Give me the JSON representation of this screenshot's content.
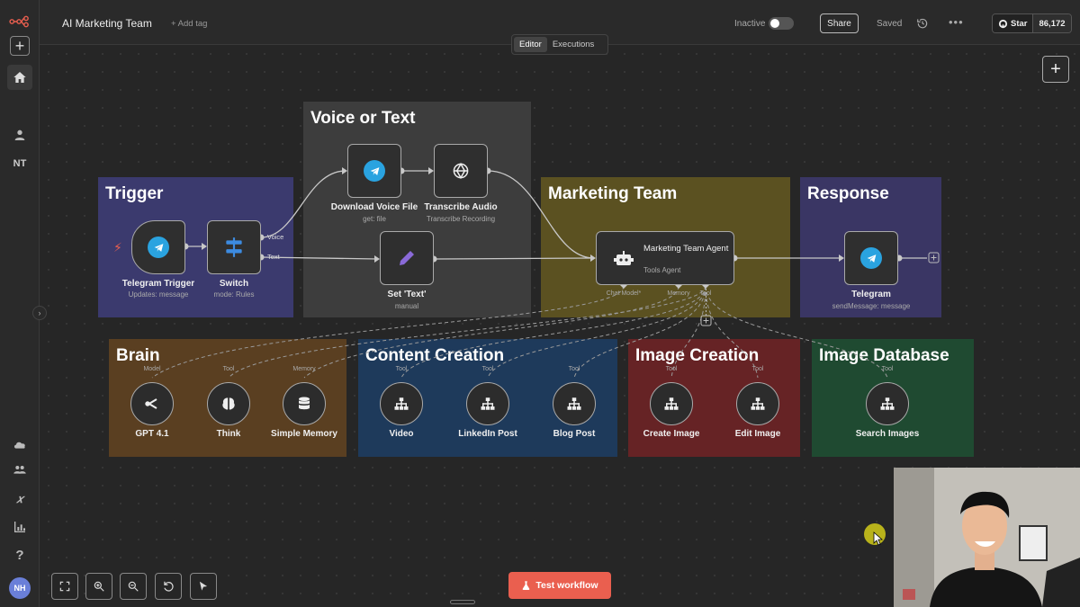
{
  "header": {
    "title": "AI Marketing Team",
    "add_tag": "+ Add tag",
    "inactive": "Inactive",
    "share": "Share",
    "saved": "Saved",
    "star": "Star",
    "star_count": "86,172"
  },
  "editor_tabs": {
    "editor": "Editor",
    "executions": "Executions"
  },
  "sidebar": {
    "nt": "NT",
    "avatar": "NH"
  },
  "groups": {
    "trigger": "Trigger",
    "voice": "Voice or Text",
    "marketing": "Marketing Team",
    "response": "Response",
    "brain": "Brain",
    "content": "Content Creation",
    "image": "Image Creation",
    "imgdb": "Image Database"
  },
  "nodes": {
    "telegram_trigger": {
      "label": "Telegram Trigger",
      "sub": "Updates: message"
    },
    "switch": {
      "label": "Switch",
      "sub": "mode: Rules",
      "port_voice": "Voice",
      "port_text": "Text"
    },
    "download_voice": {
      "label": "Download Voice File",
      "sub": "get: file"
    },
    "transcribe": {
      "label": "Transcribe Audio",
      "sub": "Transcribe Recording"
    },
    "set_text": {
      "label": "Set 'Text'",
      "sub": "manual"
    },
    "agent": {
      "label": "Marketing Team Agent",
      "sub": "Tools Agent",
      "port_model": "Chat Model*",
      "port_memory": "Memory",
      "port_tool": "Tool"
    },
    "telegram": {
      "label": "Telegram",
      "sub": "sendMessage: message"
    },
    "gpt": {
      "label": "GPT 4.1",
      "top": "Model"
    },
    "think": {
      "label": "Think",
      "top": "Tool"
    },
    "memory": {
      "label": "Simple Memory",
      "top": "Memory"
    },
    "video": {
      "label": "Video",
      "top": "Tool"
    },
    "linkedin": {
      "label": "LinkedIn Post",
      "top": "Tool"
    },
    "blog": {
      "label": "Blog Post",
      "top": "Tool"
    },
    "create_image": {
      "label": "Create Image",
      "top": "Tool"
    },
    "edit_image": {
      "label": "Edit Image",
      "top": "Tool"
    },
    "search_images": {
      "label": "Search Images",
      "top": "Tool"
    }
  },
  "toolbar": {
    "test_workflow": "Test workflow"
  },
  "colors": {
    "accent": "#ea5f4f",
    "telegram": "#2aa3e0",
    "trigger_group": "#3b3a6e",
    "voice_group": "#3d3d3d",
    "marketing_group": "#5b5121",
    "response_group": "#3a3664",
    "brain_group": "#5a3f21",
    "content_group": "#1e3a5b",
    "image_group": "#662325",
    "imgdb_group": "#1f4a31"
  }
}
